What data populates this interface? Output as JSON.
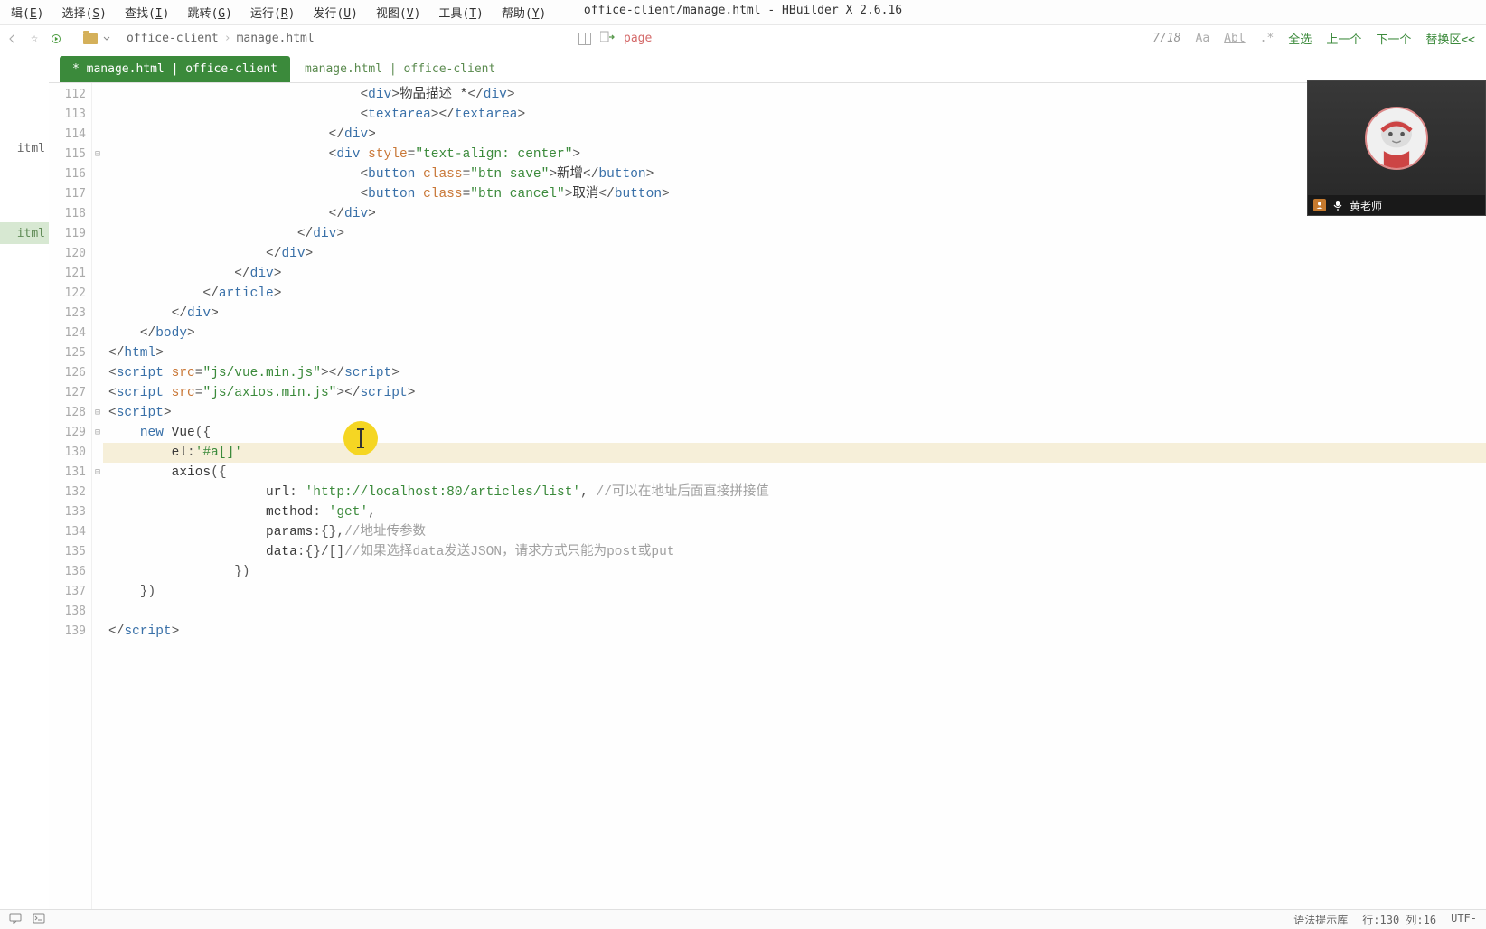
{
  "menubar": {
    "items": [
      {
        "label": "辑(E)",
        "hotkey": "E"
      },
      {
        "label": "选择(S)",
        "hotkey": "S"
      },
      {
        "label": "查找(I)",
        "hotkey": "I"
      },
      {
        "label": "跳转(G)",
        "hotkey": "G"
      },
      {
        "label": "运行(R)",
        "hotkey": "R"
      },
      {
        "label": "发行(U)",
        "hotkey": "U"
      },
      {
        "label": "视图(V)",
        "hotkey": "V"
      },
      {
        "label": "工具(T)",
        "hotkey": "T"
      },
      {
        "label": "帮助(Y)",
        "hotkey": "Y"
      }
    ]
  },
  "title": "office-client/manage.html - HBuilder X 2.6.16",
  "breadcrumb": {
    "project": "office-client",
    "file": "manage.html"
  },
  "toolbar": {
    "page_label": "page"
  },
  "findbar": {
    "count": "7/18",
    "case": "Aa",
    "word": "Abl",
    "regex": ".*",
    "select_all": "全选",
    "prev": "上一个",
    "next": "下一个",
    "replace": "替换区<<"
  },
  "left_sidebar": {
    "item_top": "itml",
    "item_sel": "itml"
  },
  "tabs": [
    {
      "label": "* manage.html | office-client",
      "active": true
    },
    {
      "label": "manage.html | office-client",
      "active": false
    }
  ],
  "video": {
    "name": "黄老师"
  },
  "statusbar": {
    "grammar": "语法提示库",
    "cursor": "行:130 列:16",
    "encoding": "UTF-"
  },
  "code_lines": [
    {
      "n": 112,
      "fold": "",
      "spans": [
        [
          "ws",
          "                                "
        ],
        [
          "pun",
          "<"
        ],
        [
          "tag",
          "div"
        ],
        [
          "pun",
          ">"
        ],
        [
          "txt",
          "物品描述 *"
        ],
        [
          "pun",
          "</"
        ],
        [
          "tag",
          "div"
        ],
        [
          "pun",
          ">"
        ]
      ]
    },
    {
      "n": 113,
      "fold": "",
      "spans": [
        [
          "ws",
          "                                "
        ],
        [
          "pun",
          "<"
        ],
        [
          "tag",
          "textarea"
        ],
        [
          "pun",
          ">"
        ],
        [
          "pun",
          "</"
        ],
        [
          "tag",
          "textarea"
        ],
        [
          "pun",
          ">"
        ]
      ]
    },
    {
      "n": 114,
      "fold": "",
      "spans": [
        [
          "ws",
          "                            "
        ],
        [
          "pun",
          "</"
        ],
        [
          "tag",
          "div"
        ],
        [
          "pun",
          ">"
        ]
      ]
    },
    {
      "n": 115,
      "fold": "⊟",
      "spans": [
        [
          "ws",
          "                            "
        ],
        [
          "pun",
          "<"
        ],
        [
          "tag",
          "div"
        ],
        [
          "txt",
          " "
        ],
        [
          "attr",
          "style"
        ],
        [
          "pun",
          "="
        ],
        [
          "str",
          "\"text-align: center\""
        ],
        [
          "pun",
          ">"
        ]
      ]
    },
    {
      "n": 116,
      "fold": "",
      "spans": [
        [
          "ws",
          "                                "
        ],
        [
          "pun",
          "<"
        ],
        [
          "tag",
          "button"
        ],
        [
          "txt",
          " "
        ],
        [
          "attr",
          "class"
        ],
        [
          "pun",
          "="
        ],
        [
          "str",
          "\"btn save\""
        ],
        [
          "pun",
          ">"
        ],
        [
          "txt",
          "新增"
        ],
        [
          "pun",
          "</"
        ],
        [
          "tag",
          "button"
        ],
        [
          "pun",
          ">"
        ]
      ]
    },
    {
      "n": 117,
      "fold": "",
      "spans": [
        [
          "ws",
          "                                "
        ],
        [
          "pun",
          "<"
        ],
        [
          "tag",
          "button"
        ],
        [
          "txt",
          " "
        ],
        [
          "attr",
          "class"
        ],
        [
          "pun",
          "="
        ],
        [
          "str",
          "\"btn cancel\""
        ],
        [
          "pun",
          ">"
        ],
        [
          "txt",
          "取消"
        ],
        [
          "pun",
          "</"
        ],
        [
          "tag",
          "button"
        ],
        [
          "pun",
          ">"
        ]
      ]
    },
    {
      "n": 118,
      "fold": "",
      "spans": [
        [
          "ws",
          "                            "
        ],
        [
          "pun",
          "</"
        ],
        [
          "tag",
          "div"
        ],
        [
          "pun",
          ">"
        ]
      ]
    },
    {
      "n": 119,
      "fold": "",
      "spans": [
        [
          "ws",
          "                        "
        ],
        [
          "pun",
          "</"
        ],
        [
          "tag",
          "div"
        ],
        [
          "pun",
          ">"
        ]
      ]
    },
    {
      "n": 120,
      "fold": "",
      "spans": [
        [
          "ws",
          "                    "
        ],
        [
          "pun",
          "</"
        ],
        [
          "tag",
          "div"
        ],
        [
          "pun",
          ">"
        ]
      ]
    },
    {
      "n": 121,
      "fold": "",
      "spans": [
        [
          "ws",
          "                "
        ],
        [
          "pun",
          "</"
        ],
        [
          "tag",
          "div"
        ],
        [
          "pun",
          ">"
        ]
      ]
    },
    {
      "n": 122,
      "fold": "",
      "spans": [
        [
          "ws",
          "            "
        ],
        [
          "pun",
          "</"
        ],
        [
          "tag",
          "article"
        ],
        [
          "pun",
          ">"
        ]
      ]
    },
    {
      "n": 123,
      "fold": "",
      "spans": [
        [
          "ws",
          "        "
        ],
        [
          "pun",
          "</"
        ],
        [
          "tag",
          "div"
        ],
        [
          "pun",
          ">"
        ]
      ]
    },
    {
      "n": 124,
      "fold": "",
      "spans": [
        [
          "ws",
          "    "
        ],
        [
          "pun",
          "</"
        ],
        [
          "tag",
          "body"
        ],
        [
          "pun",
          ">"
        ]
      ]
    },
    {
      "n": 125,
      "fold": "",
      "spans": [
        [
          "pun",
          "</"
        ],
        [
          "tag",
          "html"
        ],
        [
          "pun",
          ">"
        ]
      ]
    },
    {
      "n": 126,
      "fold": "",
      "spans": [
        [
          "pun",
          "<"
        ],
        [
          "tag",
          "script"
        ],
        [
          "txt",
          " "
        ],
        [
          "attr",
          "src"
        ],
        [
          "pun",
          "="
        ],
        [
          "str",
          "\"js/vue.min.js\""
        ],
        [
          "pun",
          ">"
        ],
        [
          "pun",
          "</"
        ],
        [
          "tag",
          "script"
        ],
        [
          "pun",
          ">"
        ]
      ]
    },
    {
      "n": 127,
      "fold": "",
      "spans": [
        [
          "pun",
          "<"
        ],
        [
          "tag",
          "script"
        ],
        [
          "txt",
          " "
        ],
        [
          "attr",
          "src"
        ],
        [
          "pun",
          "="
        ],
        [
          "str",
          "\"js/axios.min.js\""
        ],
        [
          "pun",
          ">"
        ],
        [
          "pun",
          "</"
        ],
        [
          "tag",
          "script"
        ],
        [
          "pun",
          ">"
        ]
      ]
    },
    {
      "n": 128,
      "fold": "⊟",
      "spans": [
        [
          "pun",
          "<"
        ],
        [
          "tag",
          "script"
        ],
        [
          "pun",
          ">"
        ]
      ]
    },
    {
      "n": 129,
      "fold": "⊟",
      "spans": [
        [
          "ws",
          "    "
        ],
        [
          "kw",
          "new"
        ],
        [
          "txt",
          " "
        ],
        [
          "ident",
          "Vue"
        ],
        [
          "pun",
          "({"
        ]
      ]
    },
    {
      "n": 130,
      "fold": "",
      "hl": true,
      "spans": [
        [
          "ws",
          "        "
        ],
        [
          "ident",
          "el"
        ],
        [
          "pun",
          ":"
        ],
        [
          "str",
          "'#a[]'"
        ]
      ]
    },
    {
      "n": 131,
      "fold": "⊟",
      "spans": [
        [
          "ws",
          "        "
        ],
        [
          "ident",
          "axios"
        ],
        [
          "pun",
          "({"
        ]
      ]
    },
    {
      "n": 132,
      "fold": "",
      "spans": [
        [
          "ws",
          "                    "
        ],
        [
          "ident",
          "url"
        ],
        [
          "pun",
          ": "
        ],
        [
          "str",
          "'http://localhost:80/articles/list'"
        ],
        [
          "pun",
          ", "
        ],
        [
          "cmt",
          "//可以在地址后面直接拼接值"
        ]
      ]
    },
    {
      "n": 133,
      "fold": "",
      "spans": [
        [
          "ws",
          "                    "
        ],
        [
          "ident",
          "method"
        ],
        [
          "pun",
          ": "
        ],
        [
          "str",
          "'get'"
        ],
        [
          "pun",
          ","
        ]
      ]
    },
    {
      "n": 134,
      "fold": "",
      "spans": [
        [
          "ws",
          "                    "
        ],
        [
          "ident",
          "params"
        ],
        [
          "pun",
          ":{},"
        ],
        [
          "cmt",
          "//地址传参数"
        ]
      ]
    },
    {
      "n": 135,
      "fold": "",
      "spans": [
        [
          "ws",
          "                    "
        ],
        [
          "ident",
          "data"
        ],
        [
          "pun",
          ":{}/[]"
        ],
        [
          "cmt",
          "//如果选择data发送JSON，请求方式只能为post或put"
        ]
      ]
    },
    {
      "n": 136,
      "fold": "",
      "spans": [
        [
          "ws",
          "                "
        ],
        [
          "pun",
          "})"
        ]
      ]
    },
    {
      "n": 137,
      "fold": "",
      "spans": [
        [
          "ws",
          "    "
        ],
        [
          "pun",
          "})"
        ]
      ]
    },
    {
      "n": 138,
      "fold": "",
      "spans": [
        [
          "ws",
          ""
        ]
      ]
    },
    {
      "n": 139,
      "fold": "",
      "spans": [
        [
          "pun",
          "</"
        ],
        [
          "tag",
          "script"
        ],
        [
          "pun",
          ">"
        ]
      ]
    }
  ]
}
